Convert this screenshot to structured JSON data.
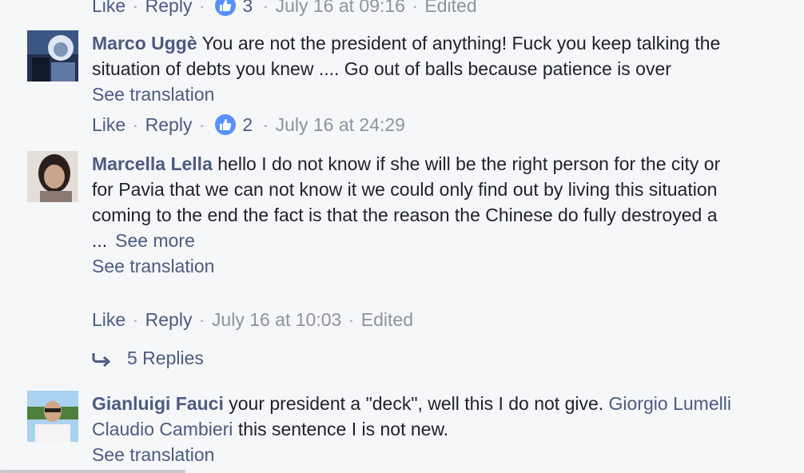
{
  "top_comment_actions": {
    "like": "Like",
    "reply": "Reply",
    "like_count": "3",
    "timestamp": "July 16 at 09:16",
    "edited": "Edited"
  },
  "comments": [
    {
      "author": "Marco Uggè",
      "text_line1": "You are not the president of anything! Fuck you keep talking the",
      "text_line2": "situation of debts you knew .... Go out of balls because patience is over",
      "see_translation": "See translation",
      "like": "Like",
      "reply": "Reply",
      "like_count": "2",
      "timestamp": "July 16 at 24:29"
    },
    {
      "author": "Marcella Lella",
      "text_line1": "hello I do not know if she will be the right person for the city or",
      "text_line2": "for Pavia that we can not know it we could only find out by living this situation",
      "text_line3": "coming to the end the fact is that the reason the Chinese do fully destroyed a",
      "text_line4": "...",
      "see_more": "See more",
      "see_translation": "See translation",
      "like": "Like",
      "reply": "Reply",
      "timestamp": "July 16 at 10:03",
      "edited": "Edited",
      "replies_label": "5 Replies"
    },
    {
      "author": "Gianluigi Fauci",
      "text_line1": "your president a \"deck\", well this I do not give.",
      "mention1": "Giorgio Lumelli",
      "mention2": "Claudio Cambieri",
      "text_line2": "this sentence I is not new.",
      "see_translation": "See translation"
    }
  ],
  "colors": {
    "background": "#f6f7f9",
    "link": "#4b5b82",
    "meta": "#8d949e",
    "like_badge": "#5890ff"
  }
}
